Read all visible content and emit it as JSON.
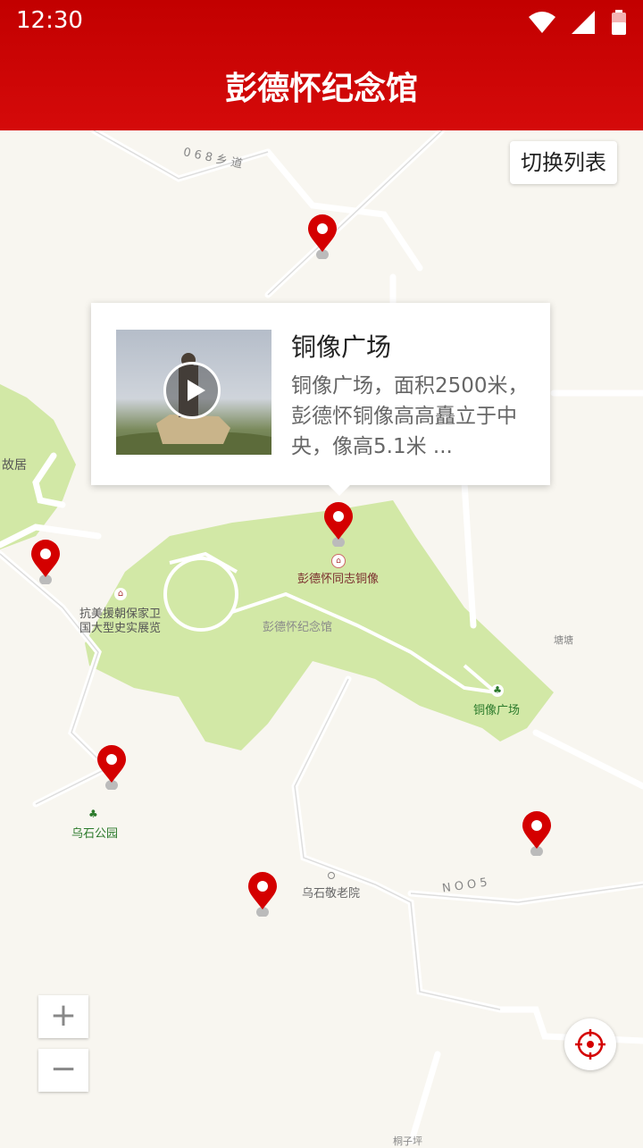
{
  "status": {
    "time": "12:30"
  },
  "header": {
    "title": "彭德怀纪念馆"
  },
  "toolbar": {
    "switch_label": "切换列表"
  },
  "popup": {
    "title": "铜像广场",
    "description": "铜像广场，面积2500米，彭德怀铜像高高矗立于中央，像高5.1米 ..."
  },
  "map_labels": {
    "road_068": "0 6 8 乡 道",
    "road_005": "N O O 5",
    "former_residence": "故居",
    "bronze_statue": "彭德怀同志铜像",
    "memorial_hall": "彭德怀纪念馆",
    "war_exhibition_1": "抗美援朝保家卫",
    "war_exhibition_2": "国大型史实展览",
    "tangtang": "塘塘",
    "bronze_square": "铜像广场",
    "wushi_park": "乌石公园",
    "nursing_home": "乌石敬老院",
    "road_bottom": "桐子坪"
  },
  "zoom": {
    "in": "+",
    "out": "−"
  },
  "icons": {
    "play": "play-icon",
    "locate": "locate-icon",
    "pin": "map-pin-icon"
  },
  "colors": {
    "header": "#c90303",
    "pin": "#d40000",
    "park": "#d2e8a6"
  }
}
